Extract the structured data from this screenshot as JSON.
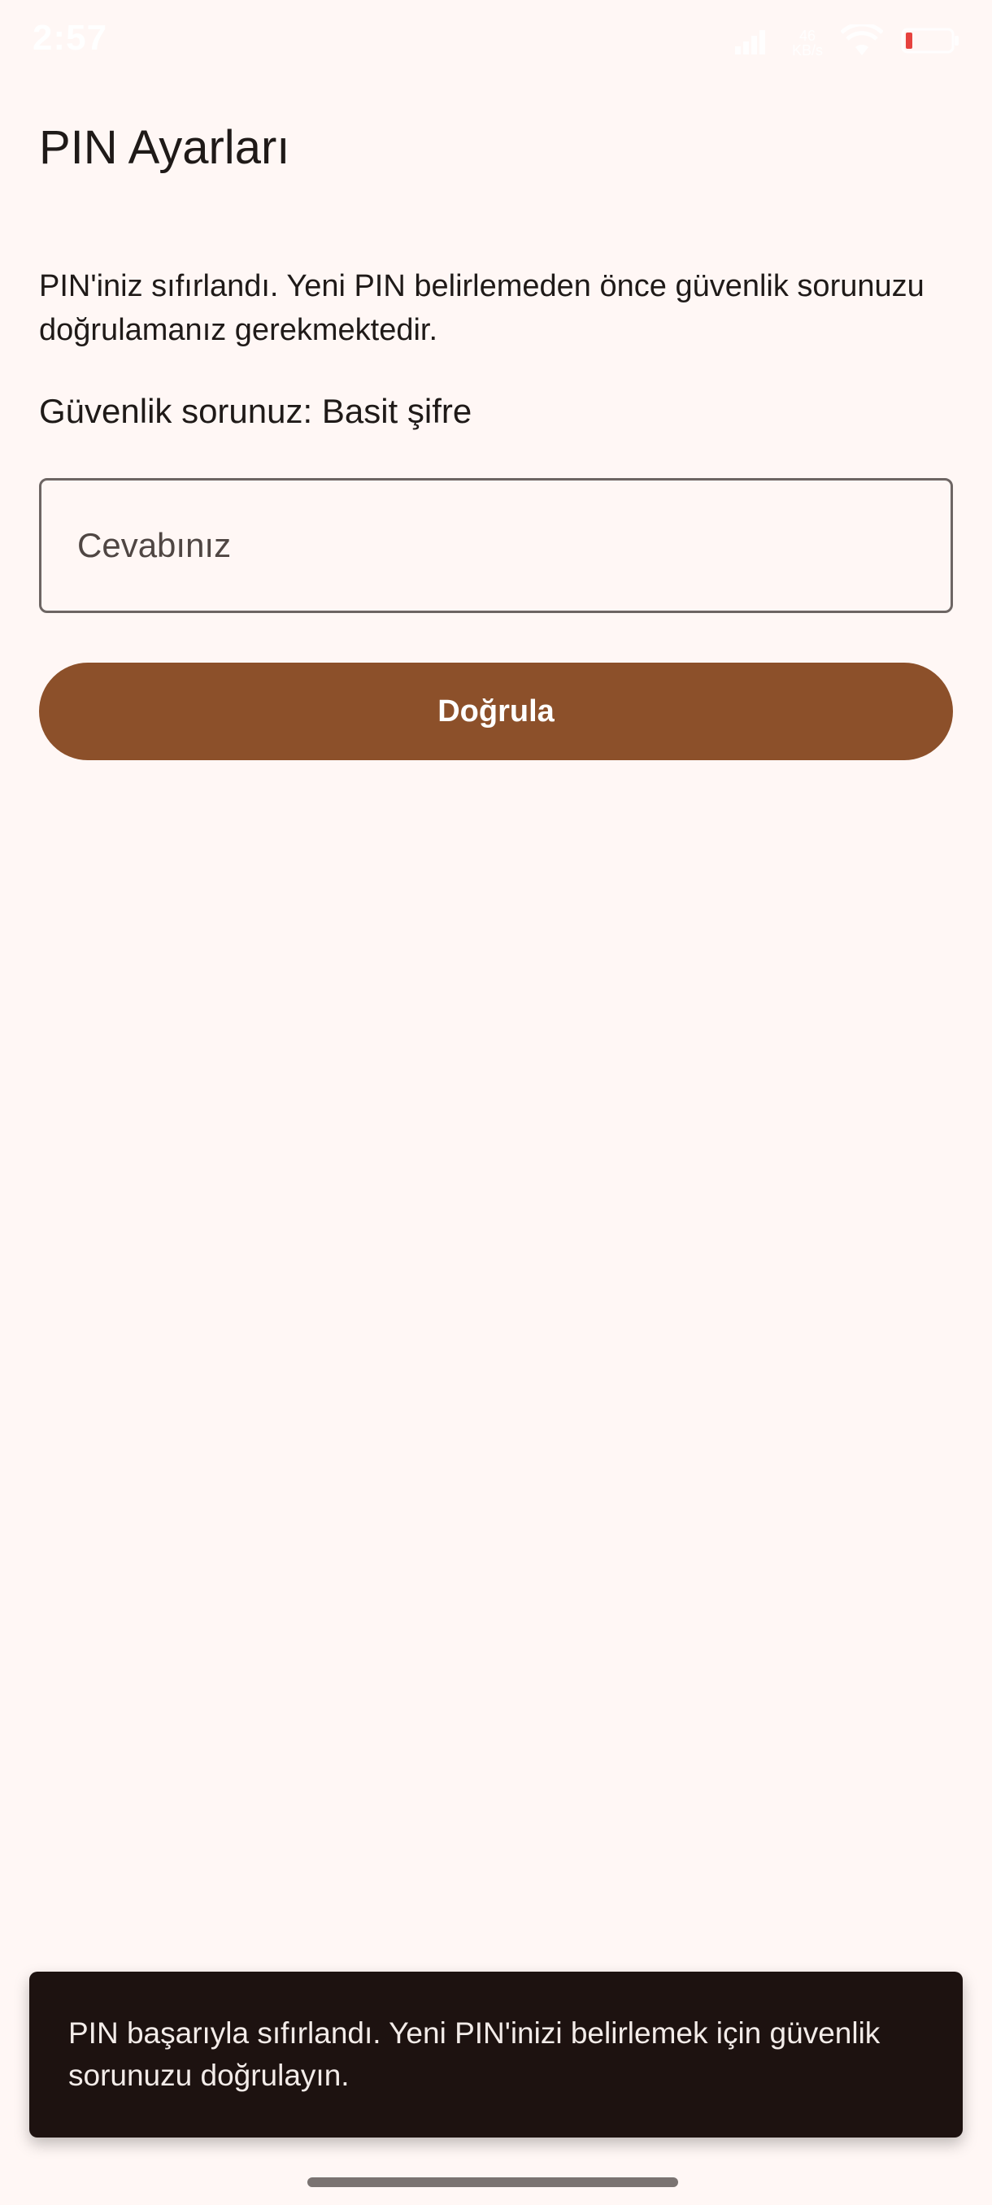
{
  "status_bar": {
    "time": "2:57",
    "network_speed_top": "46",
    "network_speed_bottom": "KB/s",
    "signal_icon": "signal-icon",
    "wifi_icon": "wifi-icon",
    "battery_icon": "battery-icon",
    "battery_color": "#e53935"
  },
  "page": {
    "title": "PIN Ayarları",
    "description": "PIN'iniz sıfırlandı. Yeni PIN belirlemeden önce güvenlik sorunuzu doğrulamanız gerekmektedir.",
    "question_label": "Güvenlik sorunuz: Basit şifre"
  },
  "form": {
    "answer_value": "",
    "answer_placeholder": "Cevabınız",
    "verify_label": "Doğrula"
  },
  "snackbar": {
    "message": "PIN başarıyla sıfırlandı. Yeni PIN'inizi belirlemek için güvenlik sorunuzu doğrulayın."
  },
  "colors": {
    "background": "#fff7f5",
    "accent": "#8c502a",
    "snackbar_bg": "#1d1210",
    "text": "#1f1a18"
  }
}
